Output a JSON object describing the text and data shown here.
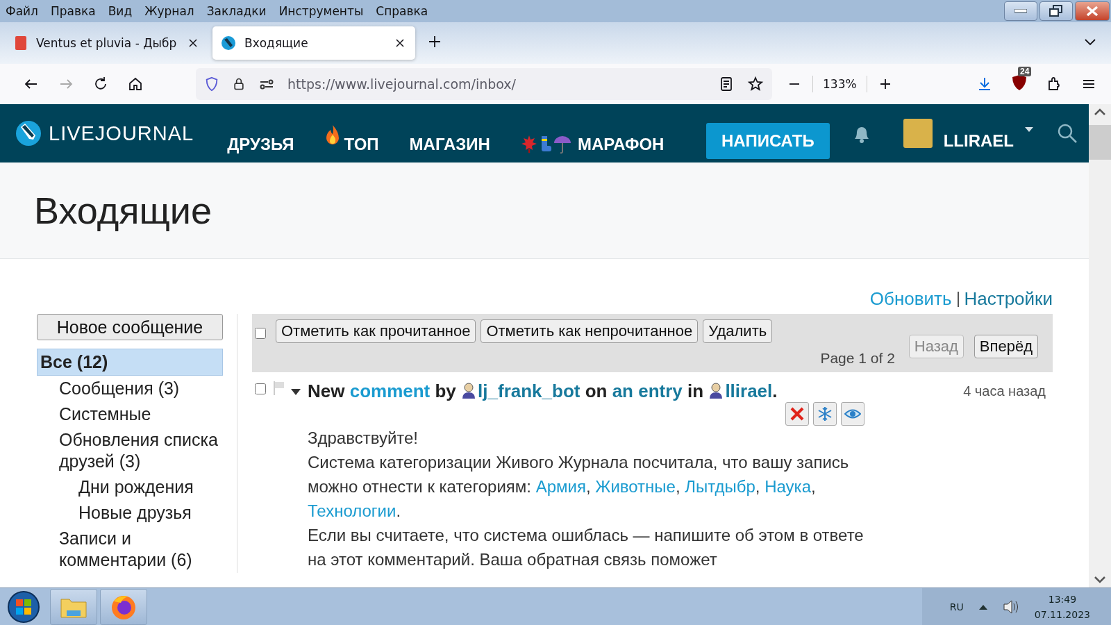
{
  "menu_bar": [
    "Файл",
    "Правка",
    "Вид",
    "Журнал",
    "Закладки",
    "Инструменты",
    "Справка"
  ],
  "tabs": [
    {
      "title": "Ventus et pluvia - Дыбр",
      "selected": false
    },
    {
      "title": "Входящие",
      "selected": true
    }
  ],
  "address_bar": {
    "url": "https://www.livejournal.com/inbox/",
    "zoom": "133%"
  },
  "extension_badge": "24",
  "site_header": {
    "logo": "LIVEJOURNAL",
    "nav": [
      {
        "label": "ДРУЗЬЯ",
        "kind": "plain"
      },
      {
        "label": "ТОП",
        "kind": "fire"
      },
      {
        "label": "МАГАЗИН",
        "kind": "plain"
      },
      {
        "label": "МАРАФОН",
        "kind": "emoji"
      }
    ],
    "write_button": "НАПИСАТЬ",
    "username": "LLIRAEL"
  },
  "page_title": "Входящие",
  "top_links": [
    "Обновить",
    "Настройки"
  ],
  "new_message_button": "Новое сообщение",
  "folders": [
    {
      "label": "Все (12)",
      "selected": true,
      "children": [
        {
          "label": "Сообщения (3)",
          "selected": false
        },
        {
          "label": "Системные",
          "selected": false
        },
        {
          "label": "Обновления списка друзей (3)",
          "selected": false,
          "children": [
            {
              "label": "Дни рождения",
              "selected": false
            },
            {
              "label": "Новые друзья",
              "selected": false
            }
          ]
        },
        {
          "label": "Записи и комментарии (6)",
          "selected": false
        }
      ]
    }
  ],
  "toolbar": {
    "select_all_checked": false,
    "actions": [
      "Отметить как прочитанное",
      "Отметить как непрочитанное",
      "Удалить"
    ],
    "page_info": "Page 1 of 2",
    "prev": {
      "label": "Назад",
      "disabled": true
    },
    "next": {
      "label": "Вперёд",
      "disabled": false
    }
  },
  "messages": [
    {
      "checked": false,
      "flagged": false,
      "expanded": true,
      "time": "4 часа назад",
      "heading": [
        {
          "kind": "text",
          "text": "New "
        },
        {
          "kind": "link",
          "text": "comment"
        },
        {
          "kind": "text",
          "text": " by "
        },
        {
          "kind": "user",
          "text": "lj_frank_bot"
        },
        {
          "kind": "text",
          "text": " on "
        },
        {
          "kind": "dark-link",
          "text": "an entry"
        },
        {
          "kind": "text",
          "text": " in "
        },
        {
          "kind": "user",
          "text": "llirael"
        },
        {
          "kind": "text",
          "text": "."
        }
      ],
      "body": [
        [
          {
            "kind": "text",
            "text": "Здравствуйте!"
          }
        ],
        [
          {
            "kind": "text",
            "text": "Система категоризации Живого Журнала посчитала, что вашу запись можно отнести к категориям: "
          },
          {
            "kind": "link",
            "text": "Армия"
          },
          {
            "kind": "text",
            "text": ", "
          },
          {
            "kind": "link",
            "text": "Животные"
          },
          {
            "kind": "text",
            "text": ", "
          },
          {
            "kind": "link",
            "text": "Лытдыбр"
          },
          {
            "kind": "text",
            "text": ", "
          },
          {
            "kind": "link",
            "text": "Наука"
          },
          {
            "kind": "text",
            "text": ", "
          },
          {
            "kind": "link",
            "text": "Технологии"
          },
          {
            "kind": "text",
            "text": "."
          }
        ],
        [
          {
            "kind": "text",
            "text": "Если вы считаете, что система ошиблась — напишите об этом в ответе на этот комментарий. Ваша обратная связь поможет"
          }
        ]
      ]
    }
  ],
  "taskbar": {
    "language": "RU",
    "time": "13:49",
    "date": "07.11.2023"
  }
}
